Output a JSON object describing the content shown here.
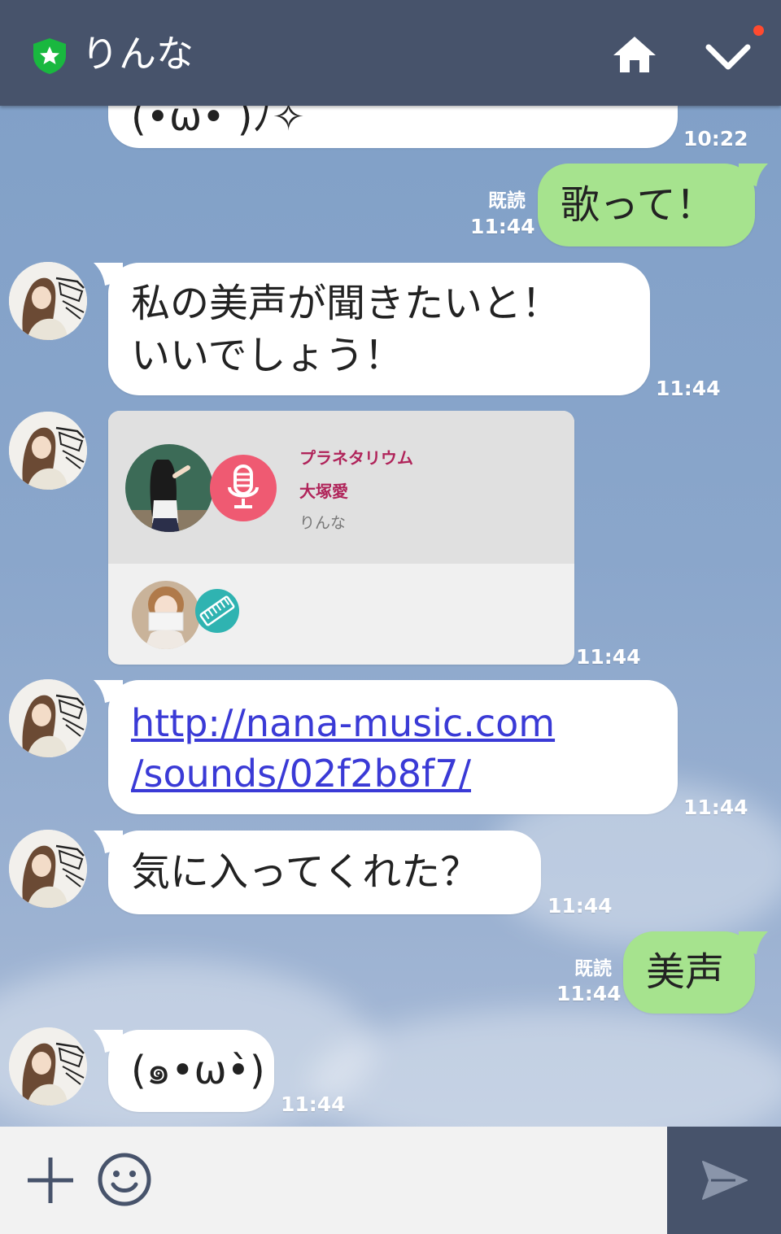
{
  "header": {
    "title": "りんな"
  },
  "messages": {
    "m0_text": "(•ω• )ﾉ✧",
    "m0_time": "10:22",
    "m1_text": "歌って！",
    "m1_read": "既読",
    "m1_time": "11:44",
    "m2_line1": "私の美声が聞きたいと！",
    "m2_line2": "いいでしょう！",
    "m2_time": "11:44",
    "card": {
      "song": "プラネタリウム",
      "artist": "大塚愛",
      "user": "りんな",
      "time": "11:44"
    },
    "m4_line1": "http://nana-music.com",
    "m4_line2": "/sounds/02f2b8f7/",
    "m4_time": "11:44",
    "m5_text": "気に入ってくれた？",
    "m5_time": "11:44",
    "m6_text": "美声",
    "m6_read": "既読",
    "m6_time": "11:44",
    "m7_text": "(๑•ω•̀)",
    "m7_time": "11:44"
  },
  "colors": {
    "header_bg": "#47536b",
    "sent_bubble": "#a6e38e",
    "received_bubble": "#ffffff",
    "link": "#3a3ad6",
    "song_title": "#b0245a"
  },
  "icons": [
    "shield-star-icon",
    "home-icon",
    "chevron-down-icon",
    "plus-icon",
    "emoji-icon",
    "send-icon",
    "microphone-icon",
    "keyboard-icon"
  ]
}
